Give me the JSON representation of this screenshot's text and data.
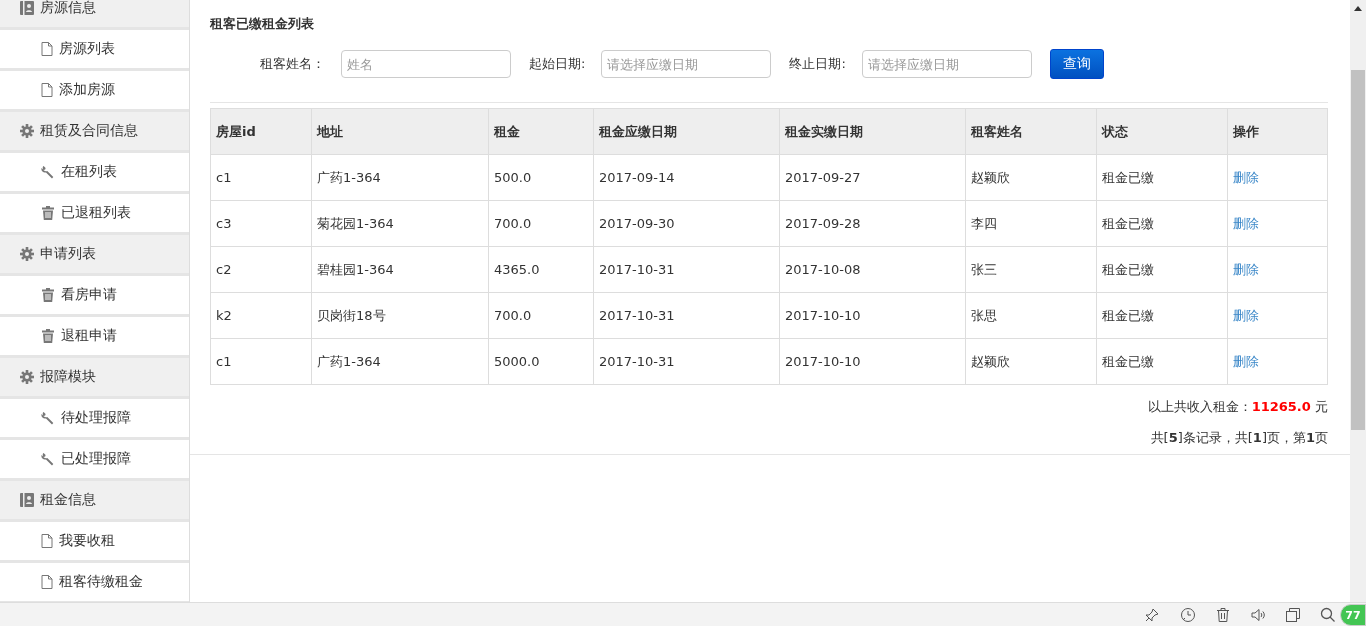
{
  "sidebar": {
    "sections": [
      {
        "label": "房源信息",
        "items": [
          {
            "label": "房源列表"
          },
          {
            "label": "添加房源"
          }
        ]
      },
      {
        "label": "租赁及合同信息",
        "items": [
          {
            "label": "在租列表"
          },
          {
            "label": "已退租列表"
          }
        ]
      },
      {
        "label": "申请列表",
        "items": [
          {
            "label": "看房申请"
          },
          {
            "label": "退租申请"
          }
        ]
      },
      {
        "label": "报障模块",
        "items": [
          {
            "label": "待处理报障"
          },
          {
            "label": "已处理报障"
          }
        ]
      },
      {
        "label": "租金信息",
        "items": [
          {
            "label": "我要收租"
          },
          {
            "label": "租客待缴租金"
          }
        ]
      }
    ]
  },
  "page_title": "租客已缴租金列表",
  "filters": [
    {
      "label": "租客姓名：",
      "placeholder": "姓名"
    },
    {
      "label": "起始日期:",
      "placeholder": "请选择应缴日期"
    },
    {
      "label": "终止日期:",
      "placeholder": "请选择应缴日期"
    }
  ],
  "search_button": "查询",
  "table": {
    "columns": [
      "房屋id",
      "地址",
      "租金",
      "租金应缴日期",
      "租金实缴日期",
      "租客姓名",
      "状态",
      "操作"
    ],
    "rows": [
      [
        "c1",
        "广药1-364",
        "500.0",
        "2017-09-14",
        "2017-09-27",
        "赵颖欣",
        "租金已缴",
        "删除"
      ],
      [
        "c3",
        "菊花园1-364",
        "700.0",
        "2017-09-30",
        "2017-09-28",
        "李四",
        "租金已缴",
        "删除"
      ],
      [
        "c2",
        "碧桂园1-364",
        "4365.0",
        "2017-10-31",
        "2017-10-08",
        "张三",
        "租金已缴",
        "删除"
      ],
      [
        "k2",
        "贝岗街18号",
        "700.0",
        "2017-10-31",
        "2017-10-10",
        "张思",
        "租金已缴",
        "删除"
      ],
      [
        "c1",
        "广药1-364",
        "5000.0",
        "2017-10-31",
        "2017-10-10",
        "赵颖欣",
        "租金已缴",
        "删除"
      ]
    ]
  },
  "total": "以上共收入租金：**11265.0** 元",
  "pagination": "共[**5**]条记录，共[**1**]页，第**1**页",
  "taskbar": {
    "badge": "77"
  }
}
